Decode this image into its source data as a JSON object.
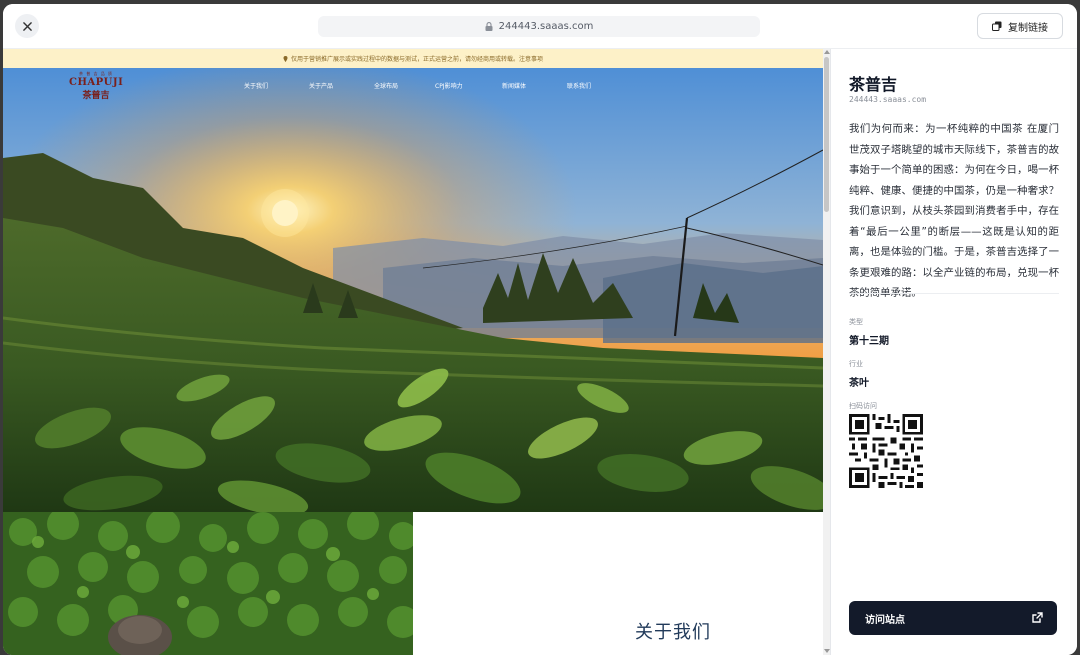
{
  "topbar": {
    "url": "244443.saaas.com",
    "copy_label": "复制链接"
  },
  "site": {
    "notice": "仅用于营销推广展示或实践过程中的数据与测试，正式运营之前，请勿经商用或转载。注意事项",
    "logo_small": "茶 普 吉 品 质",
    "logo_en": "CHAPUJI",
    "logo_cn": "茶普吉",
    "nav": [
      "关于我们",
      "关于产品",
      "全球布局",
      "CPJ影响力",
      "新闻媒体",
      "联系我们"
    ],
    "about_title": "关于我们"
  },
  "sidebar": {
    "title": "茶普吉",
    "domain": "244443.saaas.com",
    "description": "我们为何而来：为一杯纯粹的中国茶 在厦门世茂双子塔眺望的城市天际线下，茶普吉的故事始于一个简单的困惑：为何在今日，喝一杯纯粹、健康、便捷的中国茶，仍是一种奢求？我们意识到，从枝头茶园到消费者手中，存在着“最后一公里”的断层——这既是认知的距离，也是体验的门槛。于是，茶普吉选择了一条更艰难的路：以全产业链的布局，兑现一杯茶的简单承诺。",
    "period_label": "类型",
    "period_value": "第十三期",
    "industry_label": "行业",
    "industry_value": "茶叶",
    "qr_label": "扫码访问",
    "visit_label": "访问站点"
  },
  "colors": {
    "accent_dark": "#131a2a",
    "notice_bg": "#fdf1c8",
    "logo_red": "#7a1f1a"
  },
  "icons": {
    "close": "close-icon",
    "lock": "lock-icon",
    "copy": "copy-icon",
    "external": "external-link-icon",
    "location": "location-pin-icon"
  }
}
